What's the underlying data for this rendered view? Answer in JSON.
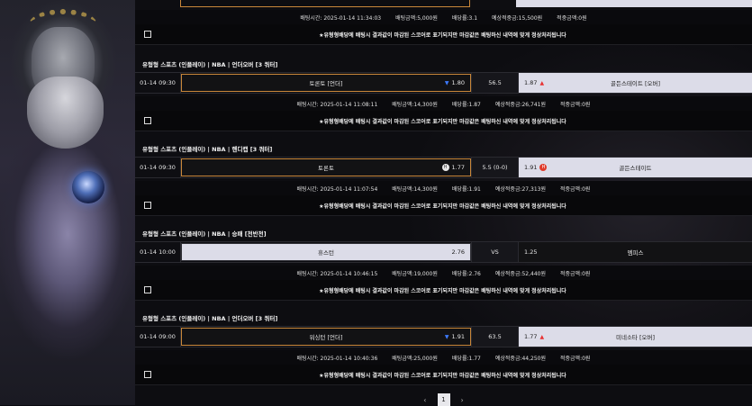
{
  "top": {
    "info": {
      "bet_time": "배팅시간: 2025-01-14 11:34:03",
      "bet_amount": "배팅금액:5,000원",
      "odds": "배당률:3.1",
      "expected": "예상적중금:15,500원",
      "won": "적중금액:0원"
    },
    "notice": "★유형형배당에 배팅시 결과값이 마감된 스코어로 표기되지만 마감값은 배팅하신 내역에 맞게 정상처리됩니다"
  },
  "bets": [
    {
      "header": "유형형 스포츠 (인플레이) | NBA | 언더오버 [3 쿼터]",
      "time": "01-14 09:30",
      "home": "토론토 [언더]",
      "home_odds": "1.80",
      "home_mark": "down",
      "handicap": "56.5",
      "away_odds": "1.87",
      "away_mark": "up",
      "away": "골든스테이트 [오버]",
      "info": {
        "bet_time": "배팅시간: 2025-01-14 11:08:11",
        "bet_amount": "배팅금액:14,300원",
        "odds": "배당률:1.87",
        "expected": "예상적중금:26,741원",
        "won": "적중금액:0원"
      },
      "notice": "★유형형배당에 배팅시 결과값이 마감된 스코어로 표기되지만 마감값은 배팅하신 내역에 맞게 정상처리됩니다"
    },
    {
      "header": "유형형 스포츠 (인플레이) | NBA | 핸디캡 [3 쿼터]",
      "time": "01-14 09:30",
      "home": "토론토",
      "home_odds": "1.77",
      "home_badge": "H",
      "handicap": "5.5 (0-0)",
      "away_odds": "1.91",
      "away_badge": "H",
      "away": "골든스테이트",
      "info": {
        "bet_time": "배팅시간: 2025-01-14 11:07:54",
        "bet_amount": "배팅금액:14,300원",
        "odds": "배당률:1.91",
        "expected": "예상적중금:27,313원",
        "won": "적중금액:0원"
      },
      "notice": "★유형형배당에 배팅시 결과값이 마감된 스코어로 표기되지만 마감값은 배팅하신 내역에 맞게 정상처리됩니다"
    },
    {
      "header": "유형형 스포츠 (인플레이) | NBA | 승패 [전반전]",
      "time": "01-14 10:00",
      "home": "휴스턴",
      "home_odds": "2.76",
      "handicap": "VS",
      "away_odds": "1.25",
      "away": "멤피스",
      "info": {
        "bet_time": "배팅시간: 2025-01-14 10:46:15",
        "bet_amount": "배팅금액:19,000원",
        "odds": "배당률:2.76",
        "expected": "예상적중금:52,440원",
        "won": "적중금액:0원"
      },
      "notice": "★유형형배당에 배팅시 결과값이 마감된 스코어로 표기되지만 마감값은 배팅하신 내역에 맞게 정상처리됩니다"
    },
    {
      "header": "유형형 스포츠 (인플레이) | NBA | 언더오버 [3 쿼터]",
      "time": "01-14 09:00",
      "home": "워싱턴 [언더]",
      "home_odds": "1.91",
      "home_mark": "down",
      "handicap": "63.5",
      "away_odds": "1.77",
      "away_mark": "up",
      "away": "미네소타 [오버]",
      "info": {
        "bet_time": "배팅시간: 2025-01-14 10:40:36",
        "bet_amount": "배팅금액:25,000원",
        "odds": "배당률:1.77",
        "expected": "예상적중금:44,250원",
        "won": "적중금액:0원"
      },
      "notice": "★유형형배당에 배팅시 결과값이 마감된 스코어로 표기되지만 마감값은 배팅하신 내역에 맞게 정상처리됩니다"
    }
  ],
  "pager": {
    "prev": "‹",
    "current": "1",
    "next": "›"
  },
  "icons": {
    "down": "arrow-down-icon",
    "up": "arrow-up-icon"
  }
}
